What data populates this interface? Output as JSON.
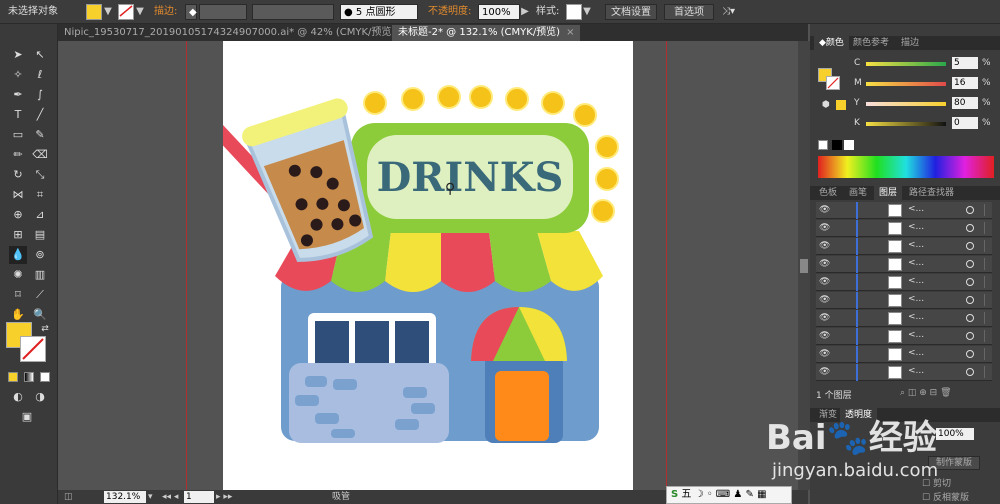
{
  "control_bar": {
    "selection_status": "未选择对象",
    "stroke_label": "描边",
    "stroke_colon": ":",
    "brush_value": "5 点圆形",
    "opacity_label": "不透明度",
    "opacity_colon": ":",
    "opacity_value": "100%",
    "style_label": "样式",
    "style_colon": ":",
    "doc_settings_button": "文档设置",
    "preferences_button": "首选项",
    "fill_color": "#f7d02c"
  },
  "tabs": [
    {
      "label": "Nipic_19530717_20190105174324907000.ai* @ 42% (CMYK/预览)",
      "close": "×"
    },
    {
      "label": "未标题-2* @ 132.1% (CMYK/预览)",
      "close": "×"
    }
  ],
  "artwork": {
    "sign_text": "DRINKS"
  },
  "status_bar": {
    "zoom": "132.1%",
    "page": "1",
    "tool_name": "吸管"
  },
  "panels": {
    "color_tabs": [
      "颜色",
      "颜色参考",
      "描边"
    ],
    "cmyk": [
      {
        "label": "C",
        "value": "5",
        "unit": "%"
      },
      {
        "label": "M",
        "value": "16",
        "unit": "%"
      },
      {
        "label": "Y",
        "value": "80",
        "unit": "%"
      },
      {
        "label": "K",
        "value": "0",
        "unit": "%"
      }
    ],
    "layer_tabs": [
      "色板",
      "画笔",
      "图层",
      "路径查找器"
    ],
    "layer_name": "<...",
    "layer_count": "1 个图层",
    "transparency_tabs": [
      "渐变",
      "透明度"
    ],
    "transparency_value": "100%",
    "make_mask": "制作蒙版",
    "clip_label": "剪切",
    "invert_mask_label": "反相蒙版"
  },
  "watermark": {
    "brand": "Bai",
    "brand_suffix": "经验",
    "url": "jingyan.baidu.com"
  },
  "ime_bar": {
    "mode": "五"
  }
}
